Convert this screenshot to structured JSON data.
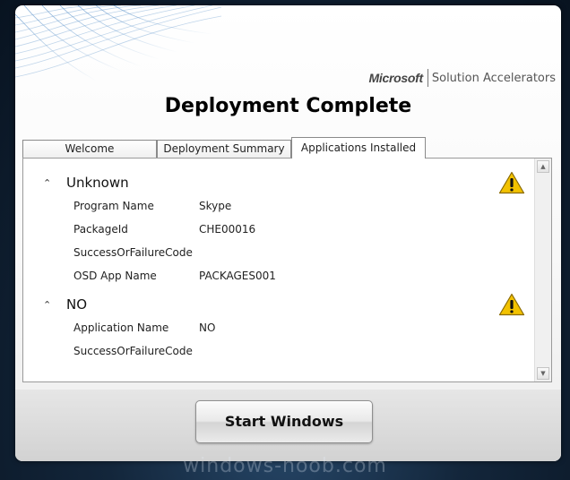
{
  "branding": {
    "company": "Microsoft",
    "product": "Solution Accelerators"
  },
  "window": {
    "title": "Deployment Complete"
  },
  "tabs": [
    {
      "label": "Welcome",
      "active": false
    },
    {
      "label": "Deployment Summary",
      "active": false
    },
    {
      "label": "Applications Installed",
      "active": true
    }
  ],
  "groups": [
    {
      "title": "Unknown",
      "fields": [
        {
          "label": "Program Name",
          "value": "Skype"
        },
        {
          "label": "PackageId",
          "value": "CHE00016"
        },
        {
          "label": "SuccessOrFailureCode",
          "value": ""
        },
        {
          "label": "OSD App Name",
          "value": "PACKAGES001"
        }
      ]
    },
    {
      "title": "NO",
      "fields": [
        {
          "label": "Application Name",
          "value": "NO"
        },
        {
          "label": "SuccessOrFailureCode",
          "value": ""
        }
      ]
    }
  ],
  "icons": {
    "collapse": "chevron-up-icon",
    "status": "warning-icon"
  },
  "buttons": {
    "start_label": "Start Windows"
  },
  "watermark": "windows-noob.com",
  "colors": {
    "warning": "#f2c200",
    "desktop": "#0d1b2b"
  }
}
